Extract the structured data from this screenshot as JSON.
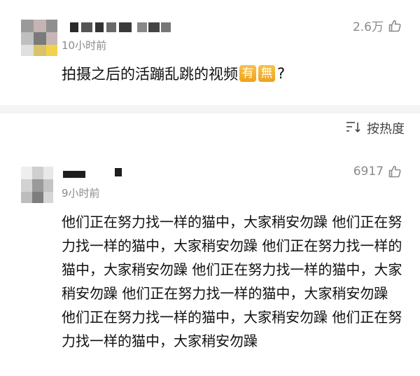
{
  "comments": [
    {
      "time": "10小时前",
      "likes": "2.6万",
      "text": "拍摄之后的活蹦乱跳的视频",
      "emoji": [
        "有",
        "無"
      ],
      "tail": "?"
    },
    {
      "time": "9小时前",
      "likes": "6917",
      "text": "他们正在努力找一样的猫中，大家稍安勿躁 他们正在努力找一样的猫中，大家稍安勿躁 他们正在努力找一样的猫中，大家稍安勿躁 他们正在努力找一样的猫中，大家稍安勿躁 他们正在努力找一样的猫中，大家稍安勿躁 他们正在努力找一样的猫中，大家稍安勿躁 他们正在努力找一样的猫中，大家稍安勿躁"
    }
  ],
  "sort": {
    "label": "按热度",
    "icon": "sort-icon"
  },
  "icons": {
    "like": "thumbs-up-icon"
  },
  "colors": {
    "text": "#111111",
    "meta": "#8a8a8a",
    "emoji_bg": "#f0a21c",
    "separator": "#f4f4f4"
  }
}
